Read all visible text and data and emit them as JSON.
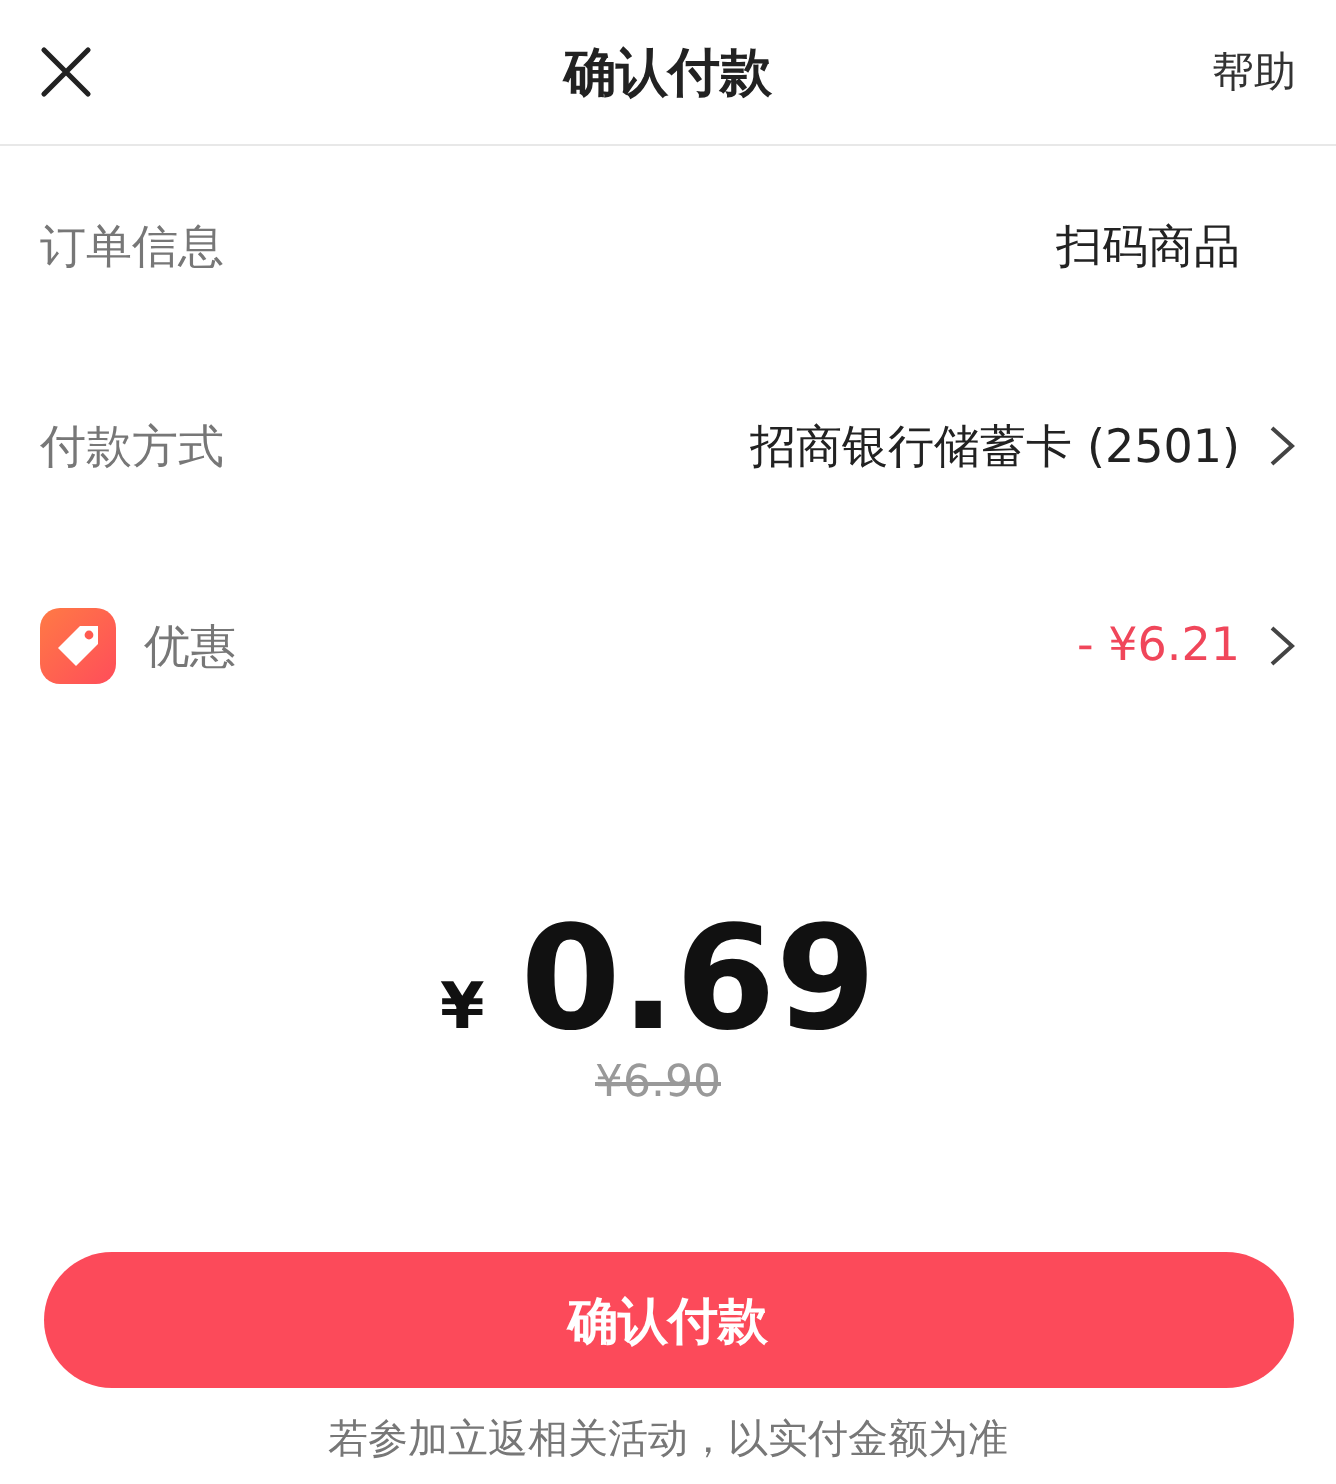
{
  "header": {
    "title": "确认付款",
    "help": "帮助"
  },
  "rows": [
    {
      "kind": "plain",
      "label": "订单信息",
      "value": "扫码商品",
      "chevron": false
    },
    {
      "kind": "plain",
      "label": "付款方式",
      "value": "招商银行储蓄卡 (2501)",
      "chevron": true
    },
    {
      "kind": "discount",
      "label": "优惠",
      "value": "- ¥6.21",
      "chevron": true
    }
  ],
  "amount": {
    "currency": "¥",
    "value": "0.69",
    "original": "¥6.90"
  },
  "confirm_button": "确认付款",
  "footnote": "若参加立返相关活动，以实付金额为准"
}
